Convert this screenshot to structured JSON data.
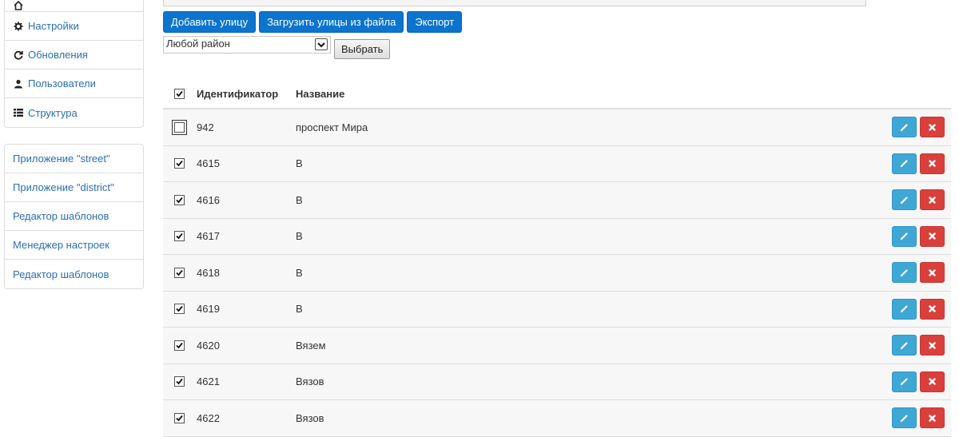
{
  "sidebar": {
    "top_items": [
      {
        "label": "",
        "icon": "home-icon"
      },
      {
        "label": "Настройки",
        "icon": "gear-icon"
      },
      {
        "label": "Обновления",
        "icon": "refresh-icon"
      },
      {
        "label": "Пользователи",
        "icon": "user-icon"
      },
      {
        "label": "Структура",
        "icon": "list-icon"
      }
    ],
    "app_items": [
      {
        "label": "Приложение \"street\""
      },
      {
        "label": "Приложение \"district\""
      },
      {
        "label": "Редактор шаблонов"
      },
      {
        "label": "Менеджер настроек"
      },
      {
        "label": "Редактор шаблонов"
      }
    ]
  },
  "toolbar": {
    "add_label": "Добавить улицу",
    "upload_label": "Загрузить улицы из файла",
    "export_label": "Экспорт"
  },
  "filter": {
    "district_selected": "Любой район",
    "choose_label": "Выбрать"
  },
  "table": {
    "headers": {
      "id": "Идентификатор",
      "name": "Название"
    },
    "header_checked": true,
    "rows": [
      {
        "id": "942",
        "name": "проспект Мира",
        "checked": false
      },
      {
        "id": "4615",
        "name": "В",
        "checked": true
      },
      {
        "id": "4616",
        "name": "В",
        "checked": true
      },
      {
        "id": "4617",
        "name": "В",
        "checked": true
      },
      {
        "id": "4618",
        "name": "В",
        "checked": true
      },
      {
        "id": "4619",
        "name": "В",
        "checked": true
      },
      {
        "id": "4620",
        "name": "Вязем",
        "checked": true
      },
      {
        "id": "4621",
        "name": "Вязов",
        "checked": true
      },
      {
        "id": "4622",
        "name": "Вязов",
        "checked": true
      }
    ]
  },
  "colors": {
    "primary": "#0a74cf",
    "edit": "#3fa7d6",
    "delete": "#d9403b",
    "link": "#2a6fb3"
  }
}
